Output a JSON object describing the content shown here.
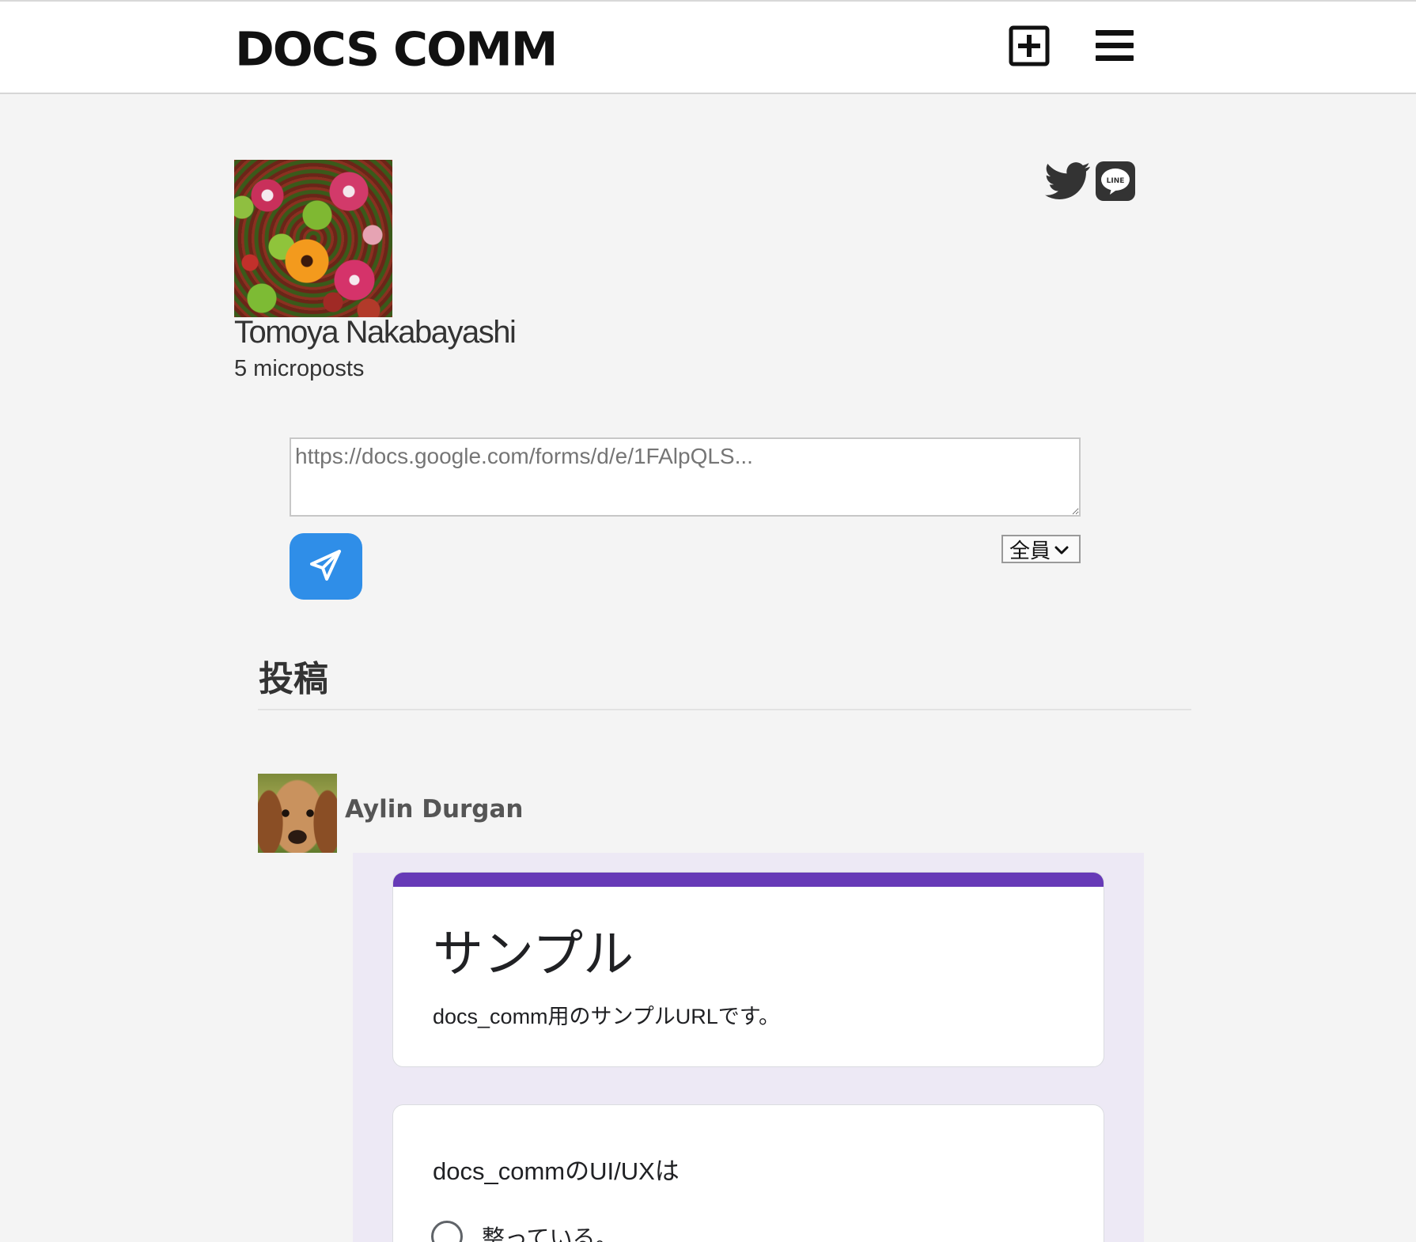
{
  "header": {
    "brand": "DOCS COMM",
    "icons": [
      "plus-square-icon",
      "hamburger-menu-icon"
    ]
  },
  "profile": {
    "name": "Tomoya Nakabayashi",
    "microposts": "5 microposts",
    "share_icons": [
      "twitter-icon",
      "line-icon"
    ]
  },
  "composer": {
    "url_value": "https://docs.google.com/forms/d/e/1FAlpQLS...",
    "audience_selected": "全員",
    "send_icon": "paper-plane-icon"
  },
  "feed": {
    "section_title": "投稿",
    "posts": [
      {
        "author": "Aylin Durgan",
        "form": {
          "title": "サンプル",
          "description": "docs_comm用のサンプルURLです。",
          "question": "docs_commのUI/UXは",
          "options": [
            "整っている。"
          ]
        }
      }
    ]
  },
  "colors": {
    "accent_blue": "#2f8ee8",
    "form_purple": "#673ab7",
    "form_bg": "#ede9f5",
    "page_bg": "#f4f4f4"
  }
}
